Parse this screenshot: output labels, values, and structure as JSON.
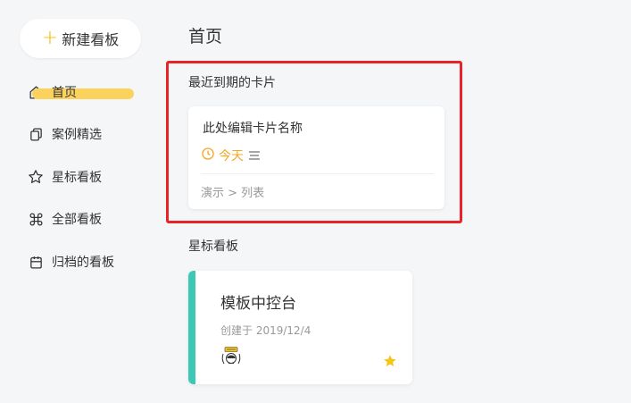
{
  "sidebar": {
    "new_board_plus": "+",
    "new_board_label": "新建看板",
    "items": [
      {
        "label": "首页",
        "icon": "home-icon",
        "active": true
      },
      {
        "label": "案例精选",
        "icon": "copy-icon"
      },
      {
        "label": "星标看板",
        "icon": "star-outline-icon"
      },
      {
        "label": "全部看板",
        "icon": "command-icon"
      },
      {
        "label": "归档的看板",
        "icon": "archive-icon"
      }
    ],
    "accent_color": "#fbd25c"
  },
  "main": {
    "title": "首页",
    "due_section": {
      "title": "最近到期的卡片",
      "card": {
        "name": "此处编辑卡片名称",
        "due": "今天",
        "path": "演示 > 列表",
        "due_color": "#f5a623"
      }
    },
    "starred_section": {
      "title": "星标看板",
      "board": {
        "name": "模板中控台",
        "created": "创建于 2019/12/4",
        "stripe_color": "#3cc8b4",
        "star_color": "#f5c518"
      }
    }
  }
}
